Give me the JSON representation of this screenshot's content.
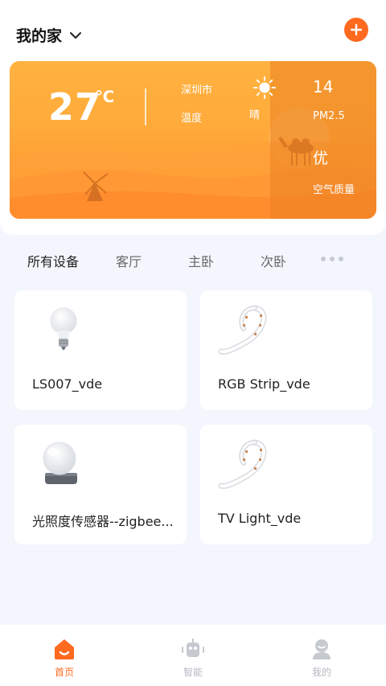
{
  "header": {
    "home_name": "我的家",
    "chevron_icon": "chevron-down-icon",
    "add_icon": "plus-icon",
    "accent_color": "#ff6a1f"
  },
  "weather": {
    "temperature": "27",
    "unit": "℃",
    "city": "深圳市",
    "humidity_label": "温度",
    "condition_icon": "sun-icon",
    "condition": "晴",
    "pm_value": "14",
    "pm_label": "PM2.5",
    "air_quality_level": "优",
    "air_quality_label": "空气质量"
  },
  "tabs": [
    {
      "label": "所有设备",
      "active": true
    },
    {
      "label": "客厅",
      "active": false
    },
    {
      "label": "主卧",
      "active": false
    },
    {
      "label": "次卧",
      "active": false
    }
  ],
  "more_icon": "more-dots-icon",
  "devices": [
    {
      "name": "LS007_vde",
      "icon": "bulb-icon"
    },
    {
      "name": "RGB Strip_vde",
      "icon": "led-strip-icon"
    },
    {
      "name": "光照度传感器--zigbee...",
      "icon": "light-sensor-icon"
    },
    {
      "name": "TV Light_vde",
      "icon": "led-strip-icon"
    }
  ],
  "bottom_nav": [
    {
      "label": "首页",
      "icon": "home-icon",
      "active": true
    },
    {
      "label": "智能",
      "icon": "robot-icon",
      "active": false
    },
    {
      "label": "我的",
      "icon": "user-icon",
      "active": false
    }
  ]
}
